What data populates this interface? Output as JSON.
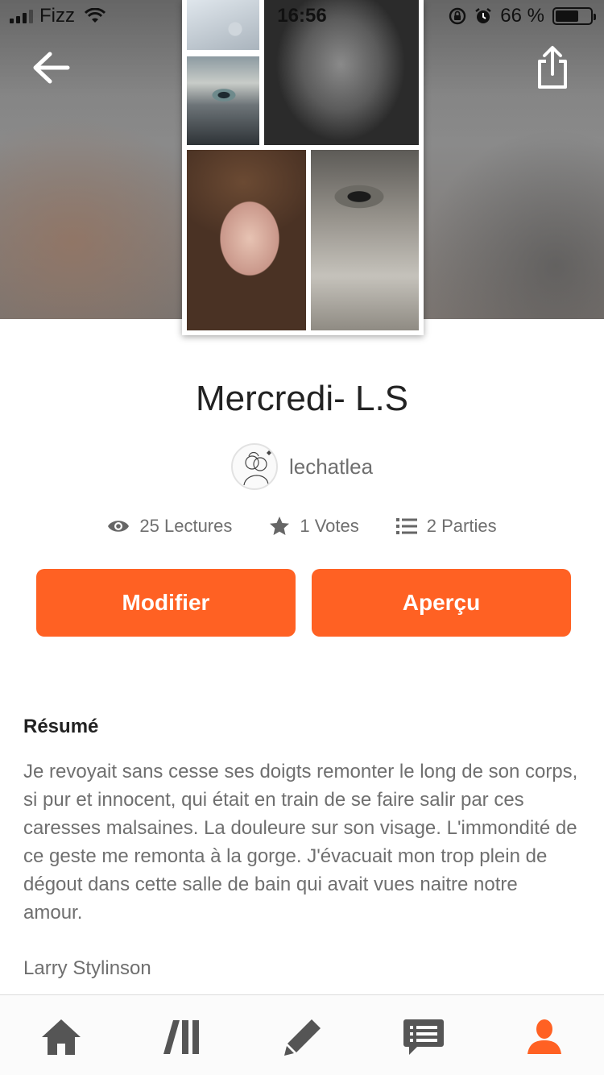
{
  "status_bar": {
    "carrier": "Fizz",
    "time": "16:56",
    "battery_percent": "66 %",
    "battery_level": 0.66
  },
  "header": {
    "back_icon": "arrow-left-icon",
    "share_icon": "share-icon"
  },
  "story": {
    "title": "Mercredi- L.S",
    "author": "lechatlea",
    "stats": {
      "reads": "25 Lectures",
      "votes": "1 Votes",
      "parts": "2 Parties"
    }
  },
  "actions": {
    "edit_label": "Modifier",
    "preview_label": "Aperçu"
  },
  "summary": {
    "heading": "Résumé",
    "text": "Je revoyait sans cesse ses doigts remonter le long de son corps, si pur et innocent, qui était en train de se faire salir par ces caresses malsaines. La douleure sur son visage. L'immondité de ce geste me remonta à la gorge. J'évacuait mon trop plein de dégout dans cette salle de bain qui avait vues naitre notre amour.",
    "tags": "Larry Stylinson"
  },
  "bottom_nav": {
    "items": [
      "home-icon",
      "library-icon",
      "write-icon",
      "messages-icon",
      "profile-icon"
    ],
    "active": "profile-icon"
  },
  "colors": {
    "accent": "#ff6123",
    "text_primary": "#222222",
    "text_secondary": "#6f6f6f",
    "nav_inactive": "#555555"
  }
}
